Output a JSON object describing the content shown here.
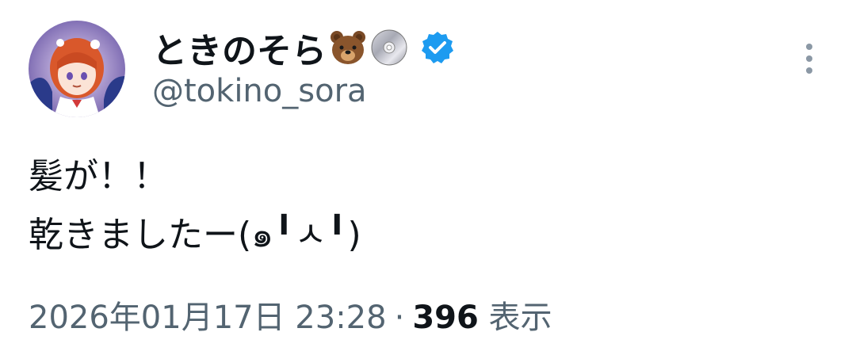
{
  "author": {
    "display_name": "ときのそら",
    "name_emojis": [
      "bear-face-emoji",
      "optical-disc-emoji"
    ],
    "verified_icon": "verified-badge-icon",
    "handle": "@tokino_sora",
    "avatar": "anime-avatar"
  },
  "more_icon": "more-vertical-icon",
  "tweet": {
    "lines": [
      "髪が！！",
      "乾きましたー(๑╹ㅅ╹)"
    ]
  },
  "meta": {
    "timestamp": "2026年01月17日 23:28",
    "separator": "·",
    "view_count": "396",
    "view_label": "表示"
  },
  "colors": {
    "text": "#0f1419",
    "muted": "#536471",
    "verified": "#1d9bf0"
  }
}
